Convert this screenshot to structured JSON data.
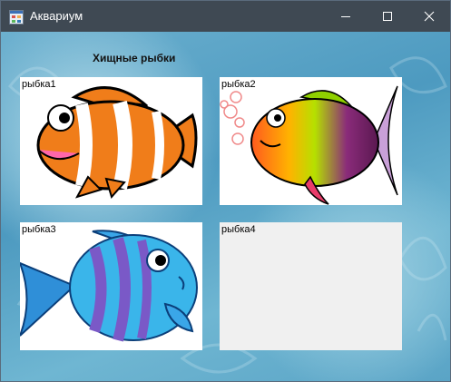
{
  "window": {
    "title": "Аквариум",
    "icons": {
      "app": "app-form-icon",
      "minimize": "minimize-icon",
      "maximize": "maximize-icon",
      "close": "close-icon"
    }
  },
  "heading": "Хищные рыбки",
  "fish": [
    {
      "label": "рыбка1",
      "picture": "clownfish"
    },
    {
      "label": "рыбка2",
      "picture": "rainbow-fish"
    },
    {
      "label": "рыбка3",
      "picture": "striped-blue-fish"
    },
    {
      "label": "рыбка4",
      "picture": ""
    }
  ],
  "colors": {
    "titlebar": "#3f4953",
    "water": "#5aa4c6",
    "empty_panel": "#f0f0f0"
  }
}
